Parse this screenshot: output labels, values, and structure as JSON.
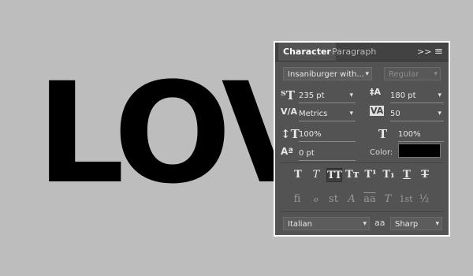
{
  "canvas": {
    "text": "LOV"
  },
  "panel": {
    "tabs": [
      "Character",
      "Paragraph"
    ],
    "collapse_label": ">>",
    "menu_icon": "≡",
    "font_family": "Insaniburger with...",
    "font_style": "Regular",
    "font_size": "235 pt",
    "leading": "180 pt",
    "kerning": "Metrics",
    "tracking": "50",
    "vertical_scale": "100%",
    "horizontal_scale": "100%",
    "baseline_shift": "0 pt",
    "color_label": "Color:",
    "color_value": "#000000",
    "style_buttons": [
      "T",
      "T",
      "TT",
      "Tт",
      "T¹",
      "T₁",
      "T",
      "T"
    ],
    "opentype_buttons": [
      "fi",
      "ℴ",
      "st",
      "A",
      "aa",
      "T",
      "1st",
      "½"
    ],
    "language": "Italian",
    "aa_icon": "aa",
    "antialias": "Sharp"
  }
}
